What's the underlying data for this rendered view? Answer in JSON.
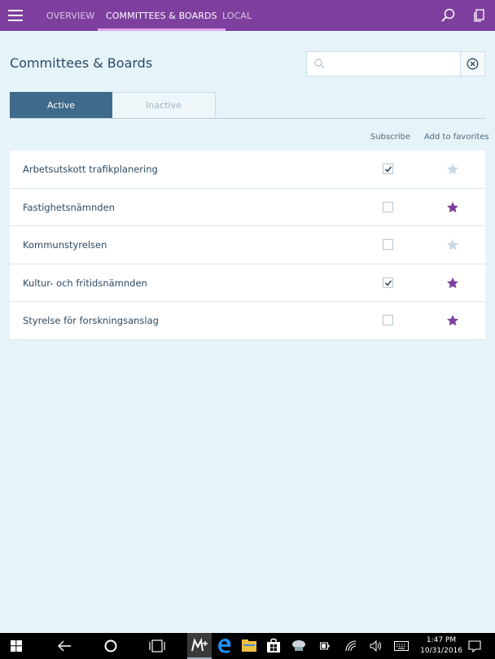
{
  "nav": {
    "tabs": [
      {
        "label": "OVERVIEW",
        "active": false
      },
      {
        "label": "COMMITTEES & BOARDS",
        "active": true
      },
      {
        "label": "LOCAL",
        "active": false
      }
    ],
    "icons": [
      "menu-icon",
      "search-icon",
      "pages-icon"
    ]
  },
  "page": {
    "title": "Committees & Boards",
    "search": {
      "value": "",
      "placeholder": ""
    }
  },
  "filter": {
    "active_label": "Active",
    "inactive_label": "Inactive",
    "selected": "Active"
  },
  "columns": {
    "subscribe": "Subscribe",
    "favorites": "Add to favorites"
  },
  "committees": [
    {
      "name": "Arbetsutskott trafikplanering",
      "subscribed": true,
      "favorite": false
    },
    {
      "name": "Fastighetsnämnden",
      "subscribed": false,
      "favorite": true
    },
    {
      "name": "Kommunstyrelsen",
      "subscribed": false,
      "favorite": false
    },
    {
      "name": "Kultur- och fritidsnämnden",
      "subscribed": true,
      "favorite": true
    },
    {
      "name": "Styrelse för forskningsanslag",
      "subscribed": false,
      "favorite": true
    }
  ],
  "colors": {
    "accent": "#7e3f9e",
    "active_segment": "#3f6a8b",
    "star_on": "#7e3f9e",
    "star_off": "#c8d8e2",
    "background": "#e6f3f9"
  },
  "taskbar": {
    "time": "1:47 PM",
    "date": "10/31/2016",
    "icons": [
      "windows-start-icon",
      "back-icon",
      "cortana-icon",
      "task-view-icon",
      "app-m-icon",
      "edge-icon",
      "file-explorer-icon",
      "store-icon",
      "app-icon",
      "battery-icon",
      "wifi-icon",
      "volume-icon",
      "keyboard-icon",
      "notifications-icon"
    ]
  }
}
